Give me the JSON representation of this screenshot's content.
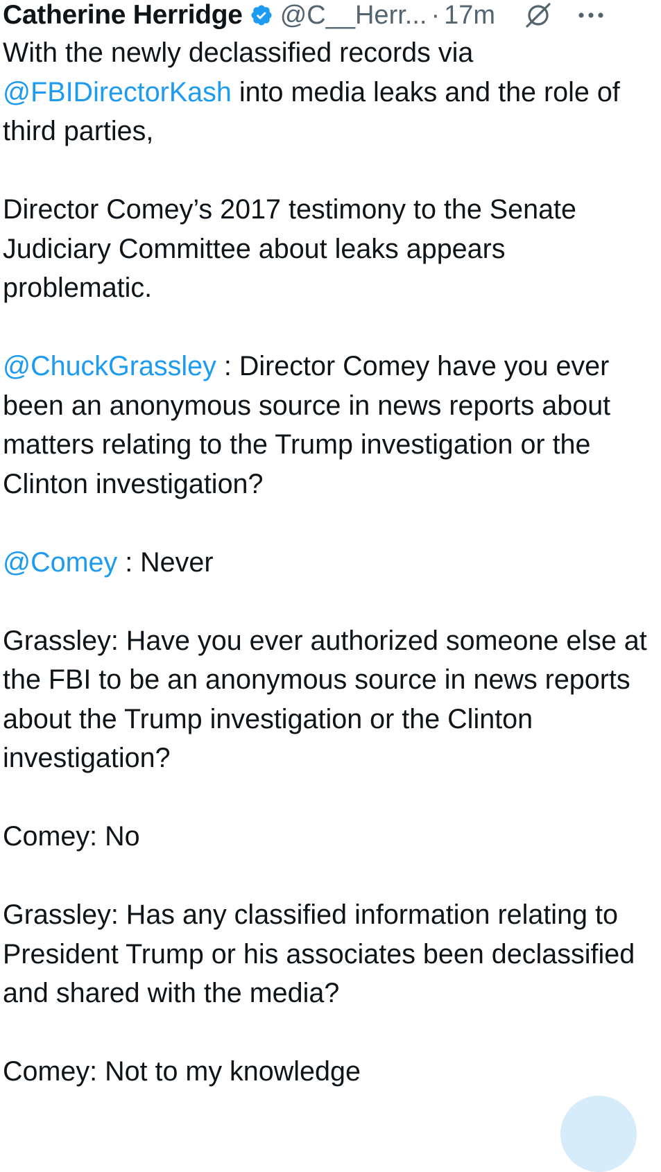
{
  "author": {
    "name": "Catherine Herridge",
    "handle": "@C__Herr...",
    "separator": "·",
    "time": "17m"
  },
  "icons": {
    "verified": "verified-badge-icon",
    "grok": "grok-icon",
    "more": "more-options-icon"
  },
  "colors": {
    "mention": "#1d9bf0",
    "verified": "#1d9bf0",
    "muted": "#536471",
    "text": "#0f1419"
  },
  "tweet": {
    "p1": {
      "a": "With the newly declassified records via ",
      "mention": "@FBIDirectorKash",
      "b": " into media leaks and the role of third parties,"
    },
    "p2": "Director Comey’s 2017 testimony to the Senate Judiciary Committee about leaks appears problematic.",
    "p3": {
      "mention": "@ChuckGrassley",
      "b": " : Director Comey have you ever been an anonymous source in news reports about matters relating to the Trump investigation or the Clinton investigation?"
    },
    "p4": {
      "mention": "@Comey",
      "b": " : Never"
    },
    "p5": "Grassley: Have you ever authorized someone else at the FBI to be an anonymous source in news reports about the Trump investigation or the Clinton investigation?",
    "p6": "Comey: No",
    "p7": "Grassley: Has any classified information relating to President Trump or his associates been declassified and shared with the media?",
    "p8": "Comey: Not to my knowledge"
  }
}
